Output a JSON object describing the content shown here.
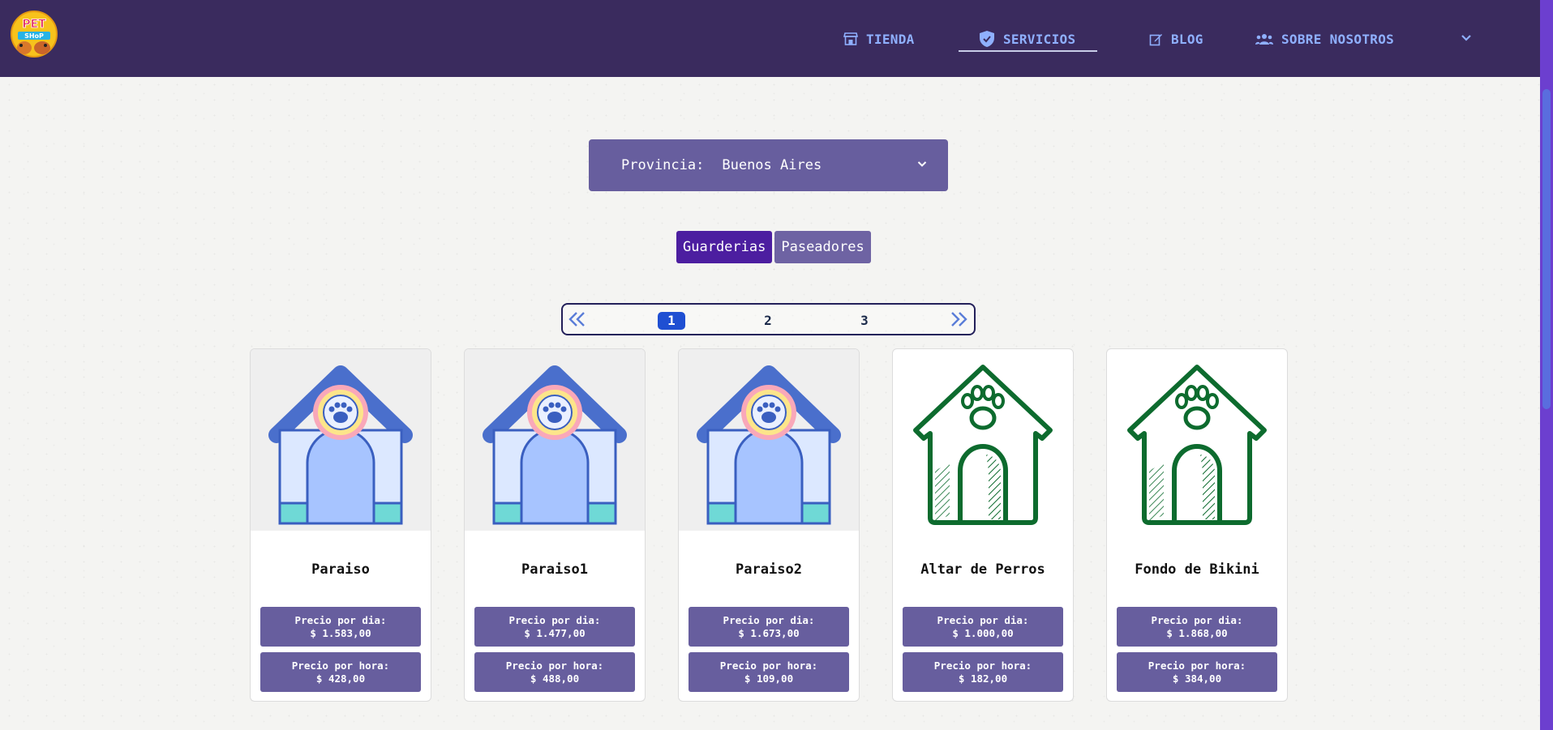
{
  "logo": {
    "text_top": "PET",
    "text_bottom": "SHoP"
  },
  "nav": {
    "items": [
      {
        "label": "TIENDA",
        "icon": "store-icon"
      },
      {
        "label": "SERVICIOS",
        "icon": "shield-icon"
      },
      {
        "label": "BLOG",
        "icon": "edit-icon"
      },
      {
        "label": "SOBRE NOSOTROS",
        "icon": "users-icon"
      }
    ],
    "active": "SERVICIOS"
  },
  "filter": {
    "label": "Provincia:",
    "value": "Buenos Aires"
  },
  "tabs": [
    {
      "label": "Guarderias",
      "active": true
    },
    {
      "label": "Paseadores",
      "active": false
    }
  ],
  "pagination": {
    "pages": [
      "1",
      "2",
      "3"
    ],
    "current": "1"
  },
  "cards": [
    {
      "name": "Paraiso",
      "day_label": "Precio por dia:",
      "day_price": "$ 1.583,00",
      "hour_label": "Precio por hora:",
      "hour_price": "$ 428,00",
      "image": "colored-doghouse"
    },
    {
      "name": "Paraiso1",
      "day_label": "Precio por dia:",
      "day_price": "$ 1.477,00",
      "hour_label": "Precio por hora:",
      "hour_price": "$ 488,00",
      "image": "colored-doghouse"
    },
    {
      "name": "Paraiso2",
      "day_label": "Precio por dia:",
      "day_price": "$ 1.673,00",
      "hour_label": "Precio por hora:",
      "hour_price": "$ 109,00",
      "image": "colored-doghouse"
    },
    {
      "name": "Altar de Perros",
      "day_label": "Precio por dia:",
      "day_price": "$ 1.000,00",
      "hour_label": "Precio por hora:",
      "hour_price": "$ 182,00",
      "image": "green-outline-doghouse"
    },
    {
      "name": "Fondo de Bikini",
      "day_label": "Precio por dia:",
      "day_price": "$ 1.868,00",
      "hour_label": "Precio por hora:",
      "hour_price": "$ 384,00",
      "image": "green-outline-doghouse"
    }
  ],
  "colors": {
    "navbar": "#3a2b5e",
    "nav_text": "#8fb0ff",
    "panel": "#675e9e",
    "tab_active": "#4c1ea0",
    "page_active": "#1f4fd2",
    "green_icon": "#0d6b2e"
  }
}
